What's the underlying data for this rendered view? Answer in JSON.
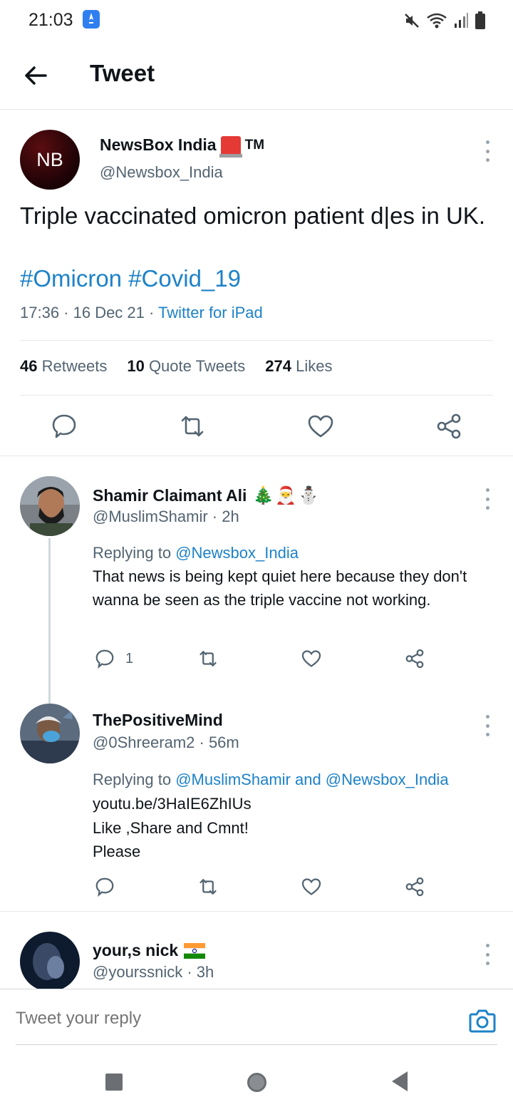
{
  "status_bar": {
    "time": "21:03"
  },
  "header": {
    "title": "Tweet"
  },
  "main_tweet": {
    "avatar_text": "NB",
    "name": "NewsBox India",
    "name_suffix": "TM",
    "handle": "@Newsbox_India",
    "text": "Triple vaccinated omicron patient d|es in UK.",
    "hashtags": "#Omicron #Covid_19",
    "time": "17:36 · 16 Dec 21 · ",
    "source": "Twitter for iPad",
    "stats": {
      "retweets_count": "46",
      "retweets_label": "Retweets",
      "quotes_count": "10",
      "quotes_label": "Quote Tweets",
      "likes_count": "274",
      "likes_label": "Likes"
    }
  },
  "replies": [
    {
      "name": "Shamir Claimant Ali",
      "emojis": "🎄🎅⛄",
      "handle": "@MuslimShamir · 2h",
      "replying_prefix": "Replying to ",
      "replying_to": "@Newsbox_India",
      "text": "That news is being kept quiet here because they don't wanna be seen as the triple vaccine not working.",
      "reply_count": "1"
    },
    {
      "name": "ThePositiveMind",
      "handle": "@0Shreeram2 · 56m",
      "replying_prefix": "Replying to ",
      "replying_to": "@MuslimShamir and @Newsbox_India",
      "link": "youtu.be/3HaIE6ZhIUs",
      "line1": "Like ,Share and Cmnt!",
      "line2": "Please"
    },
    {
      "name": "your,s nick",
      "handle": "@yourssnick · 3h"
    }
  ],
  "reply_bar": {
    "placeholder": "Tweet your reply"
  },
  "icons": [
    "back-arrow-icon",
    "more-icon",
    "reply-icon",
    "retweet-icon",
    "like-icon",
    "share-icon",
    "camera-icon"
  ],
  "colors": {
    "accent": "#1d82c8",
    "text": "#0f1419",
    "secondary": "#536471"
  }
}
